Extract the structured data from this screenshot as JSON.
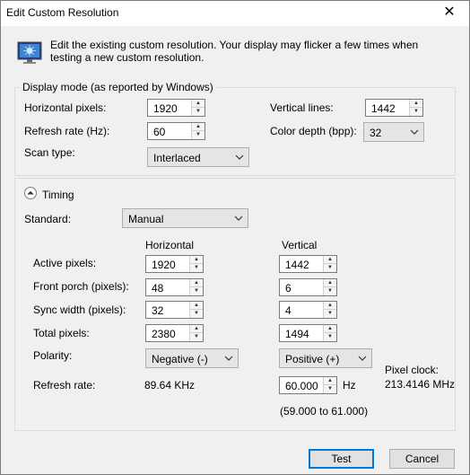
{
  "window": {
    "title": "Edit Custom Resolution",
    "close_glyph": "✕"
  },
  "intro": "Edit the existing custom resolution. Your display may flicker a few times when testing a new custom resolution.",
  "display_mode": {
    "group_title": "Display mode (as reported by Windows)",
    "horizontal_pixels_label": "Horizontal pixels:",
    "horizontal_pixels_value": "1920",
    "vertical_lines_label": "Vertical lines:",
    "vertical_lines_value": "1442",
    "refresh_rate_label": "Refresh rate (Hz):",
    "refresh_rate_value": "60",
    "color_depth_label": "Color depth (bpp):",
    "color_depth_value": "32",
    "scan_type_label": "Scan type:",
    "scan_type_value": "Interlaced"
  },
  "timing": {
    "group_title": "Timing",
    "standard_label": "Standard:",
    "standard_value": "Manual",
    "col_horizontal": "Horizontal",
    "col_vertical": "Vertical",
    "rows": {
      "active_label": "Active pixels:",
      "active_h": "1920",
      "active_v": "1442",
      "front_label": "Front porch (pixels):",
      "front_h": "48",
      "front_v": "6",
      "sync_label": "Sync width (pixels):",
      "sync_h": "32",
      "sync_v": "4",
      "total_label": "Total pixels:",
      "total_h": "2380",
      "total_v": "1494"
    },
    "polarity_label": "Polarity:",
    "polarity_h": "Negative (-)",
    "polarity_v": "Positive (+)",
    "pixel_clock_label": "Pixel clock:",
    "pixel_clock_value": "213.4146 MHz",
    "refresh_rate_label": "Refresh rate:",
    "refresh_h_value": "89.64 KHz",
    "refresh_v_value": "60.000",
    "refresh_v_unit": "Hz",
    "refresh_range": "(59.000 to 61.000)"
  },
  "buttons": {
    "test": "Test",
    "cancel": "Cancel"
  },
  "icons": {
    "monitor": "monitor-icon",
    "collapse": "chevron-up-icon"
  },
  "colors": {
    "accent": "#0078d7",
    "background": "#f0f0f0"
  }
}
